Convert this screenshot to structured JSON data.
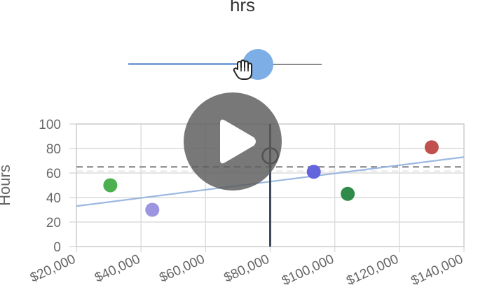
{
  "slider": {
    "title": "hrs",
    "value_fraction": 0.67,
    "accent": "#7eaee6",
    "track_color": "#8a8a8a"
  },
  "player": {
    "play_icon": "play-icon",
    "overlay_color": "#5a5a5a"
  },
  "chart_data": {
    "type": "scatter",
    "title": "",
    "xlabel": "",
    "ylabel": "Hours",
    "xlim": [
      20000,
      140000
    ],
    "ylim": [
      0,
      100
    ],
    "x_ticks": [
      20000,
      40000,
      60000,
      80000,
      100000,
      120000,
      140000
    ],
    "x_tick_labels": [
      "$20,000",
      "$40,000",
      "$60,000",
      "$80,000",
      "$100,000",
      "$120,000",
      "$140,000"
    ],
    "y_ticks": [
      0,
      20,
      40,
      60,
      80,
      100
    ],
    "y_tick_labels": [
      "0",
      "20",
      "40",
      "60",
      "80",
      "100"
    ],
    "grid": true,
    "points": [
      {
        "x": 30500,
        "y": 50,
        "color": "#4caf50"
      },
      {
        "x": 43500,
        "y": 30,
        "color": "#9e95e0"
      },
      {
        "x": 93500,
        "y": 61,
        "color": "#6464dc"
      },
      {
        "x": 104000,
        "y": 43,
        "color": "#2e8b4a"
      },
      {
        "x": 130000,
        "y": 81,
        "color": "#c0504d"
      }
    ],
    "selected_point": {
      "x": 80000,
      "y": 74
    },
    "vertical_marker_x": 80000,
    "reference_y": 65,
    "trend_line": {
      "x": [
        20000,
        140000
      ],
      "y": [
        33,
        73
      ],
      "color": "#9cb8e0"
    }
  }
}
